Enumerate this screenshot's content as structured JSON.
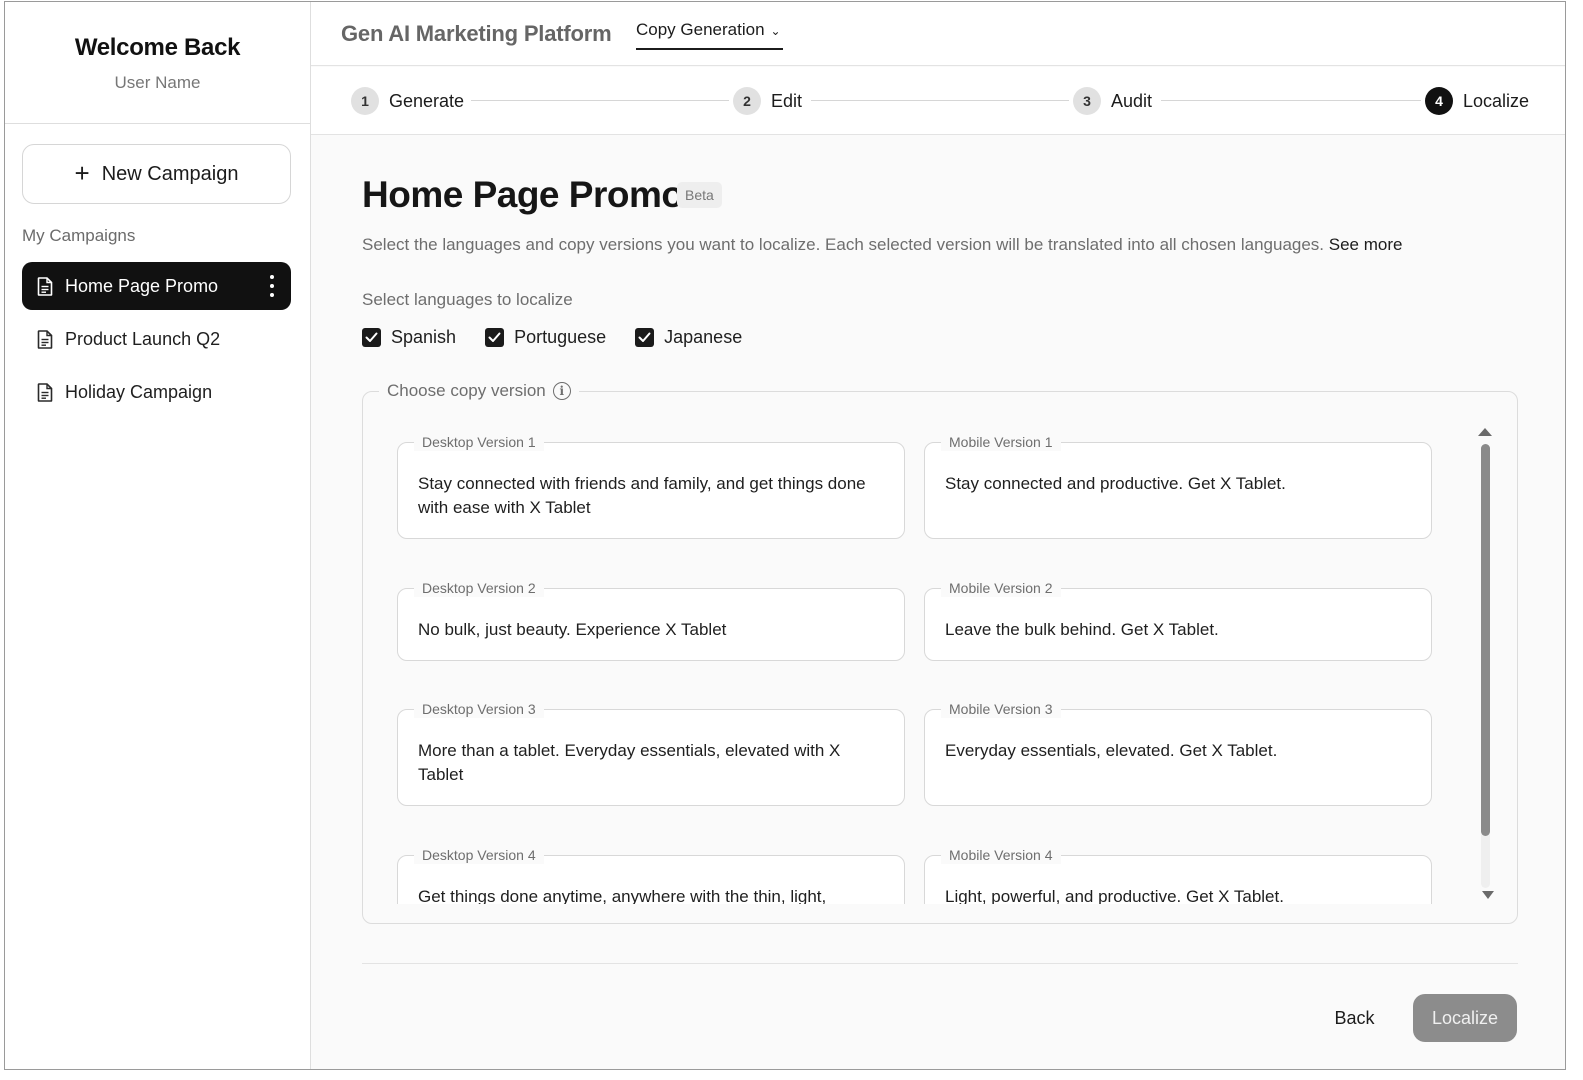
{
  "sidebar": {
    "welcome_title": "Welcome Back",
    "user_name": "User Name",
    "new_campaign_label": "New Campaign",
    "campaigns_heading": "My Campaigns",
    "items": [
      {
        "label": "Home Page Promo",
        "active": true
      },
      {
        "label": "Product Launch Q2",
        "active": false
      },
      {
        "label": "Holiday Campaign",
        "active": false
      }
    ]
  },
  "header": {
    "app_title": "Gen AI Marketing Platform",
    "nav_dropdown": "Copy Generation"
  },
  "stepper": {
    "steps": [
      {
        "number": "1",
        "label": "Generate",
        "active": false
      },
      {
        "number": "2",
        "label": "Edit",
        "active": false
      },
      {
        "number": "3",
        "label": "Audit",
        "active": false
      },
      {
        "number": "4",
        "label": "Localize",
        "active": true
      }
    ]
  },
  "main": {
    "title": "Home Page Promo",
    "badge": "Beta",
    "description": "Select the languages and copy versions you want to localize. Each selected version will be translated into all chosen languages.",
    "see_more": "See more",
    "languages_heading": "Select languages to localize",
    "languages": [
      {
        "label": "Spanish",
        "checked": true
      },
      {
        "label": "Portuguese",
        "checked": true
      },
      {
        "label": "Japanese",
        "checked": true
      }
    ],
    "copy_version_legend": "Choose copy version",
    "copy_versions": [
      {
        "label": "Desktop Version 1",
        "text": "Stay connected with friends and family, and get things done with ease with X Tablet"
      },
      {
        "label": "Mobile Version 1",
        "text": "Stay connected and productive. Get X Tablet."
      },
      {
        "label": "Desktop Version 2",
        "text": "No bulk, just beauty. Experience X Tablet"
      },
      {
        "label": "Mobile Version 2",
        "text": "Leave the bulk behind. Get X Tablet."
      },
      {
        "label": "Desktop Version 3",
        "text": "More than a tablet. Everyday essentials, elevated with X Tablet"
      },
      {
        "label": "Mobile Version 3",
        "text": "Everyday essentials, elevated. Get X Tablet."
      },
      {
        "label": "Desktop Version 4",
        "text": "Get things done anytime, anywhere with the thin, light,"
      },
      {
        "label": "Mobile Version 4",
        "text": "Light, powerful, and productive. Get X Tablet."
      }
    ]
  },
  "footer": {
    "back_label": "Back",
    "localize_label": "Localize"
  },
  "colors": {
    "accent": "#111111",
    "disabled_button": "#8c8c8c",
    "background": "#fafafa"
  }
}
